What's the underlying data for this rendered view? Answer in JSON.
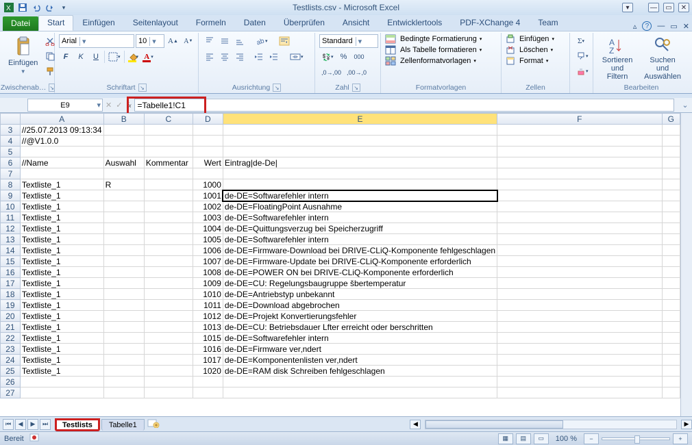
{
  "app": {
    "title": "Testlists.csv - Microsoft Excel"
  },
  "window": {
    "minimize": "—",
    "maximize": "▭",
    "close": "✕"
  },
  "qat": {
    "excel_icon": "excel-icon",
    "save": "save",
    "undo": "undo",
    "redo": "redo",
    "customize": "▾"
  },
  "tabs": {
    "file": "Datei",
    "items": [
      "Start",
      "Einfügen",
      "Seitenlayout",
      "Formeln",
      "Daten",
      "Überprüfen",
      "Ansicht",
      "Entwicklertools",
      "PDF-XChange 4",
      "Team"
    ],
    "active": "Start",
    "help": "?"
  },
  "ribbon": {
    "clipboard": {
      "paste": "Einfügen",
      "label": "Zwischenab…"
    },
    "font": {
      "name": "Arial",
      "size": "10",
      "bold": "F",
      "italic": "K",
      "underline": "U",
      "label": "Schriftart"
    },
    "alignment": {
      "label": "Ausrichtung",
      "wrap": "wrap",
      "merge": "merge"
    },
    "number": {
      "format": "Standard",
      "label": "Zahl"
    },
    "styles": {
      "cond": "Bedingte Formatierung",
      "table": "Als Tabelle formatieren",
      "cell": "Zellenformatvorlagen",
      "label": "Formatvorlagen"
    },
    "cells": {
      "insert": "Einfügen",
      "delete": "Löschen",
      "format": "Format",
      "label": "Zellen"
    },
    "editing": {
      "sort": "Sortieren und Filtern",
      "find": "Suchen und Auswählen",
      "label": "Bearbeiten"
    }
  },
  "cellref": {
    "name": "E9",
    "formula": "=Tabelle1!C1"
  },
  "columns": [
    "A",
    "B",
    "C",
    "D",
    "E",
    "F",
    "G"
  ],
  "col_widths": {
    "A": 65,
    "B": 62,
    "C": 72,
    "D": 48,
    "E": 382,
    "F": 310,
    "G": 30
  },
  "rows": [
    {
      "n": 3,
      "A": "//25.07.2013 09:13:34"
    },
    {
      "n": 4,
      "A": "//@V1.0.0"
    },
    {
      "n": 5
    },
    {
      "n": 6,
      "A": "//Name",
      "B": "Auswahl",
      "C": "Kommentar",
      "D": "Wert",
      "E": "Eintrag|de-De|"
    },
    {
      "n": 7
    },
    {
      "n": 8,
      "A": "Textliste_1",
      "B": "R",
      "D": "1000"
    },
    {
      "n": 9,
      "A": "Textliste_1",
      "D": "1001",
      "E": "de-DE=Softwarefehler intern",
      "selected": true
    },
    {
      "n": 10,
      "A": "Textliste_1",
      "D": "1002",
      "E": "de-DE=FloatingPoint Ausnahme"
    },
    {
      "n": 11,
      "A": "Textliste_1",
      "D": "1003",
      "E": "de-DE=Softwarefehler intern"
    },
    {
      "n": 12,
      "A": "Textliste_1",
      "D": "1004",
      "E": "de-DE=Quittungsverzug bei Speicherzugriff"
    },
    {
      "n": 13,
      "A": "Textliste_1",
      "D": "1005",
      "E": "de-DE=Softwarefehler intern"
    },
    {
      "n": 14,
      "A": "Textliste_1",
      "D": "1006",
      "E": "de-DE=Firmware-Download bei DRIVE-CLiQ-Komponente fehlgeschlagen"
    },
    {
      "n": 15,
      "A": "Textliste_1",
      "D": "1007",
      "E": "de-DE=Firmware-Update bei DRIVE-CLiQ-Komponente erforderlich"
    },
    {
      "n": 16,
      "A": "Textliste_1",
      "D": "1008",
      "E": "de-DE=POWER ON bei DRIVE-CLiQ-Komponente erforderlich"
    },
    {
      "n": 17,
      "A": "Textliste_1",
      "D": "1009",
      "E": "de-DE=CU: Regelungsbaugruppe šbertemperatur"
    },
    {
      "n": 18,
      "A": "Textliste_1",
      "D": "1010",
      "E": "de-DE=Antriebstyp unbekannt"
    },
    {
      "n": 19,
      "A": "Textliste_1",
      "D": "1011",
      "E": "de-DE=Download abgebrochen"
    },
    {
      "n": 20,
      "A": "Textliste_1",
      "D": "1012",
      "E": "de-DE=Projekt Konvertierungsfehler"
    },
    {
      "n": 21,
      "A": "Textliste_1",
      "D": "1013",
      "E": "de-DE=CU: Betriebsdauer Lfter erreicht oder berschritten"
    },
    {
      "n": 22,
      "A": "Textliste_1",
      "D": "1015",
      "E": "de-DE=Softwarefehler intern"
    },
    {
      "n": 23,
      "A": "Textliste_1",
      "D": "1016",
      "E": "de-DE=Firmware ver‚ndert"
    },
    {
      "n": 24,
      "A": "Textliste_1",
      "D": "1017",
      "E": "de-DE=Komponentenlisten ver‚ndert"
    },
    {
      "n": 25,
      "A": "Textliste_1",
      "D": "1020",
      "E": "de-DE=RAM disk Schreiben fehlgeschlagen"
    },
    {
      "n": 26
    },
    {
      "n": 27
    }
  ],
  "sheets": {
    "active": "Testlists",
    "others": [
      "Tabelle1"
    ]
  },
  "status": {
    "ready": "Bereit",
    "zoom": "100 %"
  }
}
